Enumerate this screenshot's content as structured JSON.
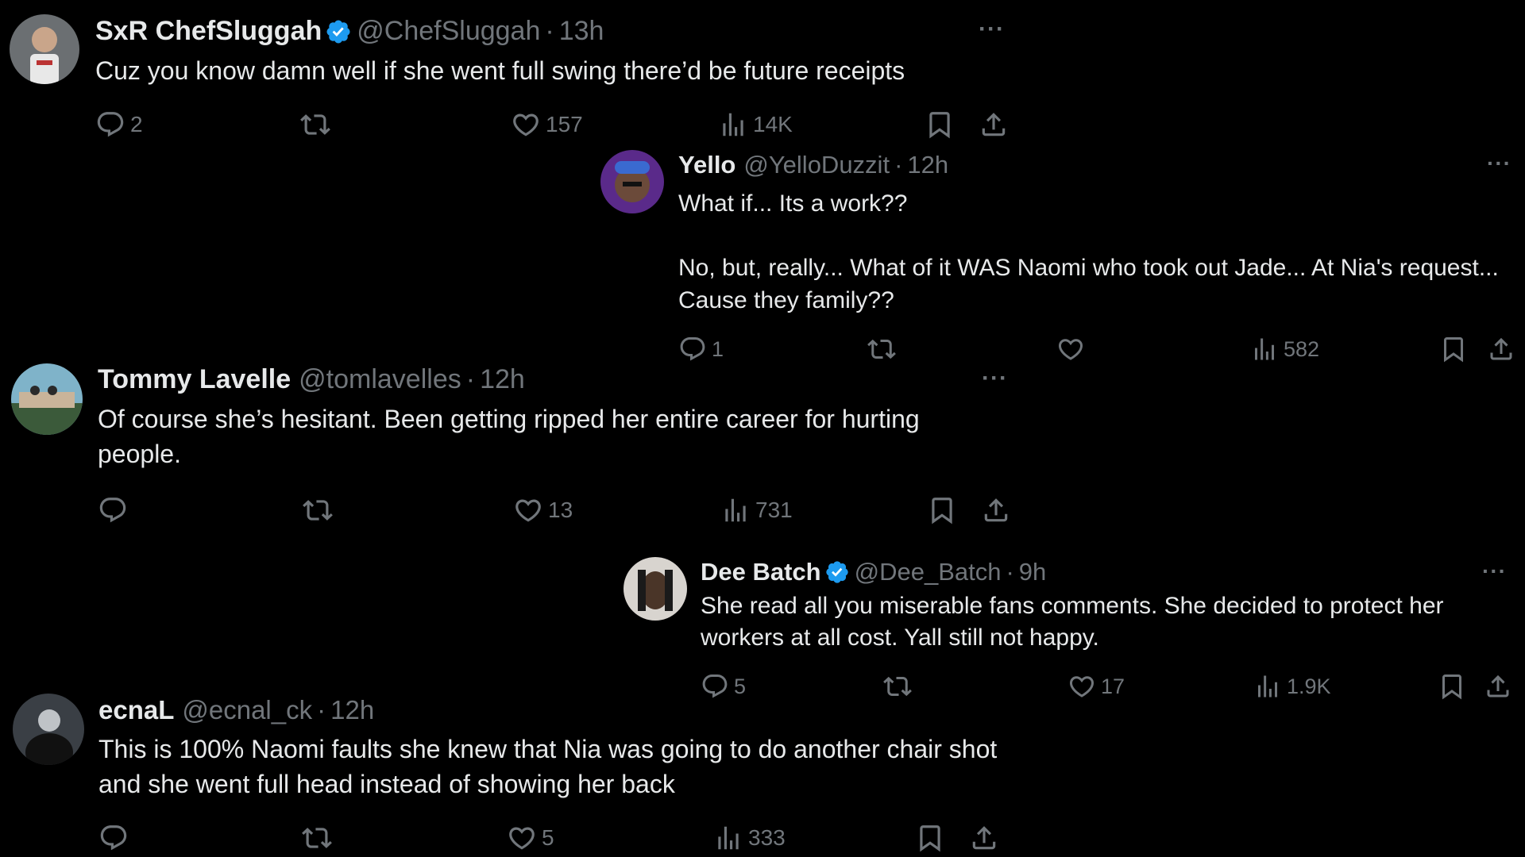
{
  "colors": {
    "background": "#000000",
    "text": "#e7e9ea",
    "muted": "#71767b",
    "verified": "#1d9bf0"
  },
  "tweets": [
    {
      "name": "SxR ChefSluggah",
      "verified": true,
      "handle": "@ChefSluggah",
      "sep": "·",
      "time": "13h",
      "more": "···",
      "text": [
        "Cuz you know damn well if she went full swing there’d be future receipts"
      ],
      "replies": "2",
      "likes": "157",
      "views": "14K"
    },
    {
      "name": "Yello",
      "verified": false,
      "handle": "@YelloDuzzit",
      "sep": "·",
      "time": "12h",
      "more": "···",
      "text": [
        "What if... Its a work??",
        "No, but, really... What of it WAS Naomi who took out Jade... At Nia's request... Cause they family??"
      ],
      "replies": "1",
      "likes": "",
      "views": "582"
    },
    {
      "name": "Tommy Lavelle",
      "verified": false,
      "handle": "@tomlavelles",
      "sep": "·",
      "time": "12h",
      "more": "···",
      "text": [
        "Of course she’s hesitant. Been getting ripped her entire career for hurting people."
      ],
      "replies": "",
      "likes": "13",
      "views": "731"
    },
    {
      "name": "Dee Batch",
      "verified": true,
      "handle": "@Dee_Batch",
      "sep": "·",
      "time": "9h",
      "more": "···",
      "text": [
        "She read all you miserable fans comments. She decided to protect her workers at all cost. Yall still not happy."
      ],
      "replies": "5",
      "likes": "17",
      "views": "1.9K"
    },
    {
      "name": "ecnaL",
      "verified": false,
      "handle": "@ecnal_ck",
      "sep": "·",
      "time": "12h",
      "more": "",
      "text": [
        "This is 100% Naomi faults she knew that Nia was going to do another chair shot and she went full head instead of showing her back"
      ],
      "replies": "",
      "likes": "5",
      "views": "333"
    }
  ]
}
